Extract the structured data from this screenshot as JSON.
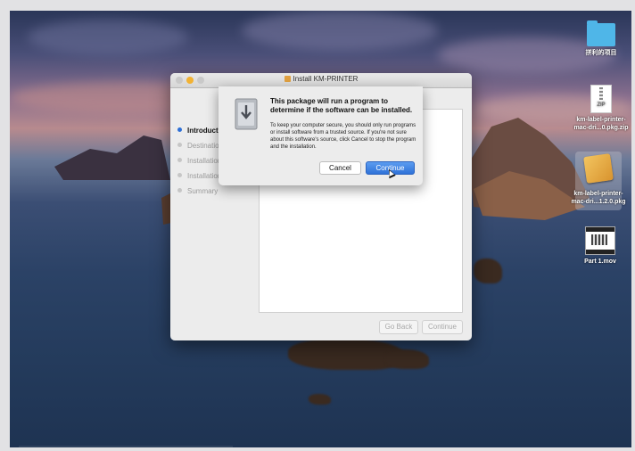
{
  "desktop": {
    "icons": [
      {
        "label": "拼利的项目",
        "kind": "folder-icon"
      },
      {
        "label": "km-label-printer-mac-dri...0.pkg.zip",
        "kind": "zip-icon",
        "badge": "ZIP"
      },
      {
        "label": "km-label-printer-mac-dri...1.2.0.pkg",
        "kind": "package-icon",
        "selected": true
      },
      {
        "label": "Part 1.mov",
        "kind": "movie-icon"
      }
    ]
  },
  "installer": {
    "title": "Install KM-PRINTER",
    "steps": [
      {
        "label": "Introduction",
        "active": true
      },
      {
        "label": "Destination Select",
        "active": false
      },
      {
        "label": "Installation Type",
        "active": false
      },
      {
        "label": "Installation",
        "active": false
      },
      {
        "label": "Summary",
        "active": false
      }
    ],
    "go_back": "Go Back",
    "continue": "Continue"
  },
  "alert": {
    "title": "This package will run a program to determine if the software can be installed.",
    "body": "To keep your computer secure, you should only run programs or install software from a trusted source. If you're not sure about this software's source, click Cancel to stop the program and the installation.",
    "cancel": "Cancel",
    "continue": "Continue"
  },
  "colors": {
    "accent": "#2f72d8",
    "active_step_dot": "#2d6fd6",
    "traffic_close": "#c9c9c9",
    "traffic_min": "#f2b233",
    "traffic_max": "#c9c9c9"
  }
}
